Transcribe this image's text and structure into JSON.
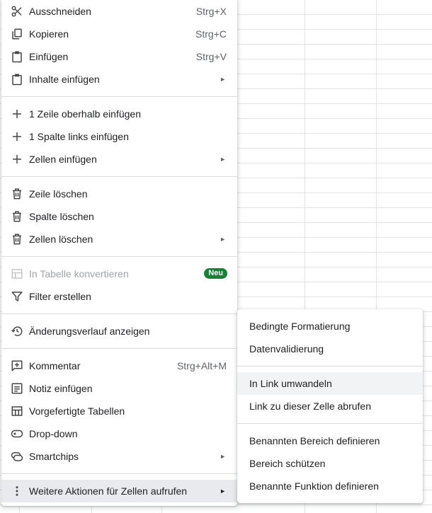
{
  "context_menu": {
    "items": [
      {
        "label": "Ausschneiden",
        "shortcut": "Strg+X",
        "icon": "scissors-icon"
      },
      {
        "label": "Kopieren",
        "shortcut": "Strg+C",
        "icon": "copy-icon"
      },
      {
        "label": "Einfügen",
        "shortcut": "Strg+V",
        "icon": "clipboard-icon"
      },
      {
        "label": "Inhalte einfügen",
        "submenu_arrow": "►",
        "icon": "clipboard-icon"
      },
      {
        "label": "1 Zeile oberhalb einfügen",
        "icon": "plus-icon"
      },
      {
        "label": "1 Spalte links einfügen",
        "icon": "plus-icon"
      },
      {
        "label": "Zellen einfügen",
        "submenu_arrow": "►",
        "icon": "plus-icon"
      },
      {
        "label": "Zeile löschen",
        "icon": "trash-icon"
      },
      {
        "label": "Spalte löschen",
        "icon": "trash-icon"
      },
      {
        "label": "Zellen löschen",
        "submenu_arrow": "►",
        "icon": "trash-icon"
      },
      {
        "label": "In Tabelle konvertieren",
        "badge": "Neu",
        "disabled": true,
        "icon": "table-icon"
      },
      {
        "label": "Filter erstellen",
        "icon": "filter-icon"
      },
      {
        "label": "Änderungsverlauf anzeigen",
        "icon": "history-icon"
      },
      {
        "label": "Kommentar",
        "shortcut": "Strg+Alt+M",
        "icon": "comment-add-icon"
      },
      {
        "label": "Notiz einfügen",
        "icon": "note-icon"
      },
      {
        "label": "Vorgefertigte Tabellen",
        "icon": "table-icon"
      },
      {
        "label": "Drop-down",
        "icon": "dropdown-chip-icon"
      },
      {
        "label": "Smartchips",
        "submenu_arrow": "►",
        "icon": "smartchip-icon"
      },
      {
        "label": "Weitere Aktionen für Zellen aufrufen",
        "submenu_arrow": "►",
        "icon": "more-vert-icon",
        "highlighted": true
      }
    ]
  },
  "submenu": {
    "items": [
      {
        "label": "Bedingte Formatierung"
      },
      {
        "label": "Datenvalidierung"
      },
      {
        "label": "In Link umwandeln",
        "highlighted": true
      },
      {
        "label": "Link zu dieser Zelle abrufen"
      },
      {
        "label": "Benannten Bereich definieren"
      },
      {
        "label": "Bereich schützen"
      },
      {
        "label": "Benannte Funktion definieren"
      }
    ]
  },
  "colors": {
    "badge": "#188038",
    "highlight": "#e8eaed",
    "icon": "#444746",
    "disabled": "#a0a3a6"
  }
}
